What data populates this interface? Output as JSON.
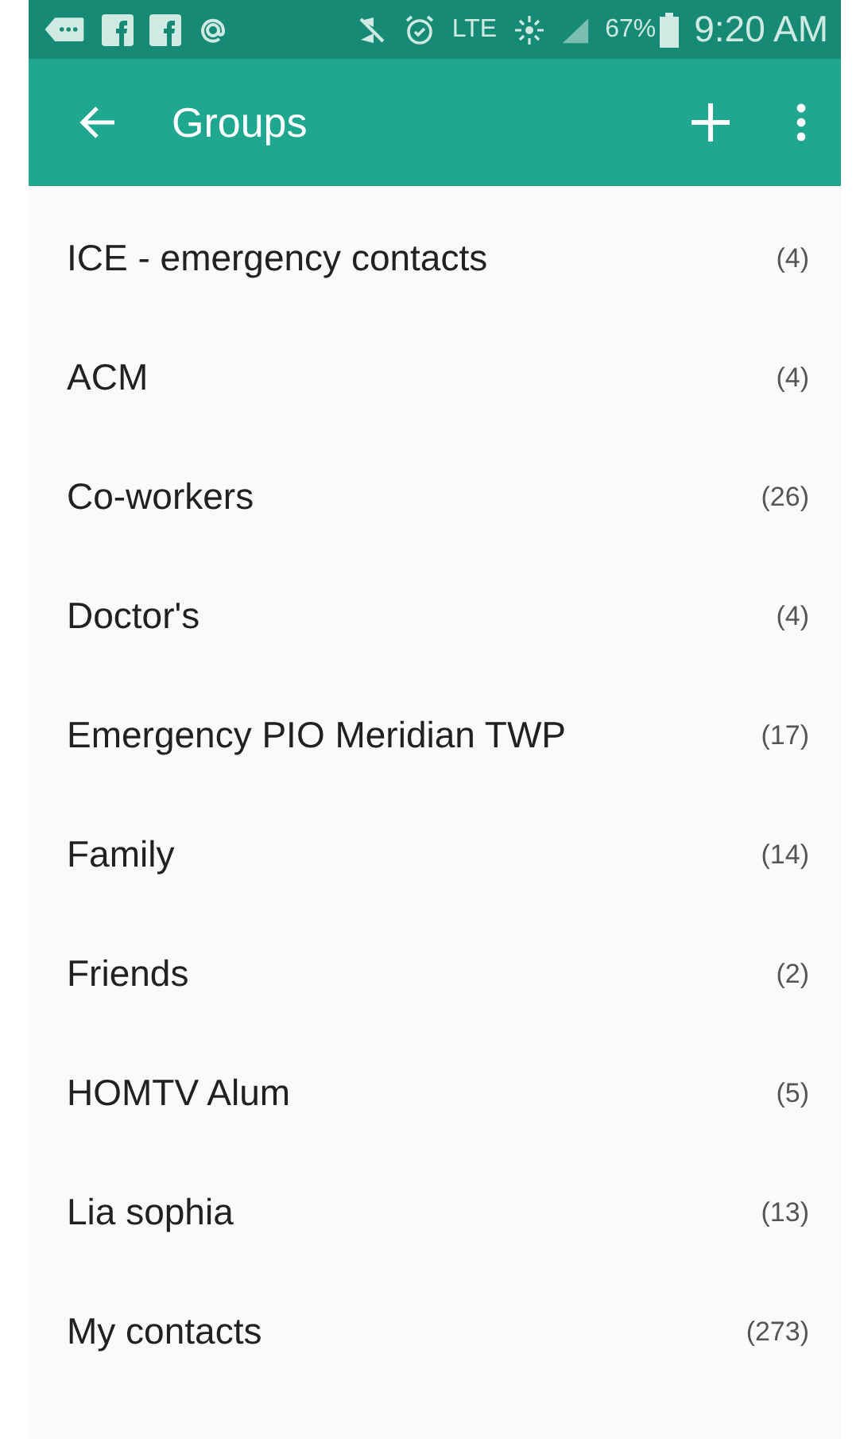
{
  "status_bar": {
    "network": "LTE",
    "battery": "67%",
    "time": "9:20 AM"
  },
  "app_bar": {
    "title": "Groups"
  },
  "groups": [
    {
      "name": "ICE - emergency contacts",
      "count": "(4)"
    },
    {
      "name": "ACM",
      "count": "(4)"
    },
    {
      "name": "Co-workers",
      "count": "(26)"
    },
    {
      "name": "Doctor's",
      "count": "(4)"
    },
    {
      "name": "Emergency PIO Meridian TWP",
      "count": "(17)"
    },
    {
      "name": "Family",
      "count": "(14)"
    },
    {
      "name": "Friends",
      "count": "(2)"
    },
    {
      "name": "HOMTV Alum",
      "count": "(5)"
    },
    {
      "name": "Lia sophia",
      "count": "(13)"
    },
    {
      "name": "My contacts",
      "count": "(273)"
    }
  ]
}
